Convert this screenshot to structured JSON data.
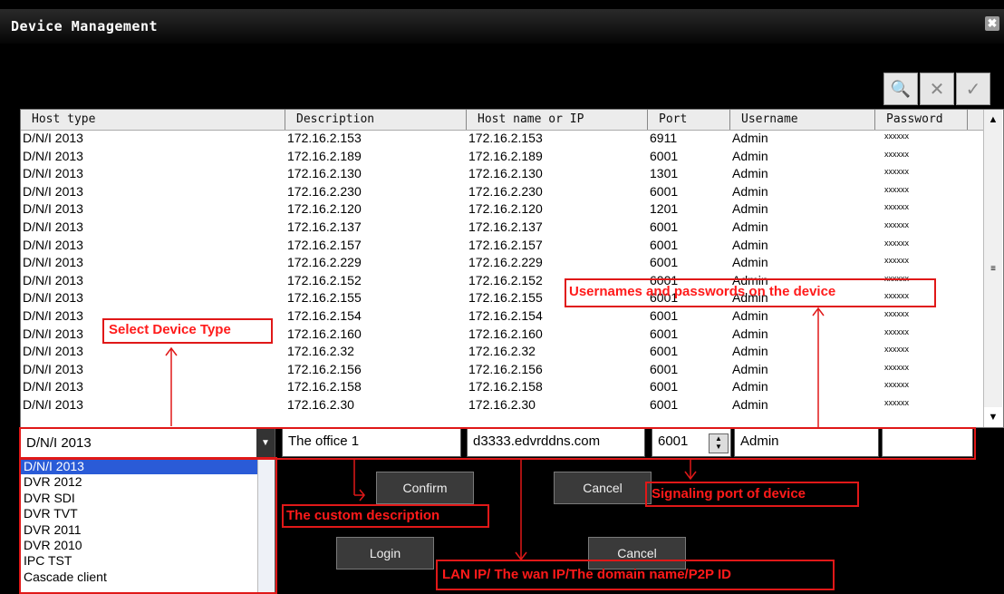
{
  "window": {
    "title": "Device Management",
    "close_glyph": "✖"
  },
  "toolbar": [
    {
      "icon": "search-icon",
      "glyph": "🔍"
    },
    {
      "icon": "delete-icon",
      "glyph": "✕"
    },
    {
      "icon": "check-icon",
      "glyph": "✓"
    }
  ],
  "grid": {
    "columns": [
      "Host type",
      "Description",
      "Host name or IP",
      "Port",
      "Username",
      "Password"
    ],
    "rows": [
      [
        "D/N/I 2013",
        "172.16.2.153",
        "172.16.2.153",
        "6911",
        "Admin",
        "xxxxxx"
      ],
      [
        "D/N/I 2013",
        "172.16.2.189",
        "172.16.2.189",
        "6001",
        "Admin",
        "xxxxxx"
      ],
      [
        "D/N/I 2013",
        "172.16.2.130",
        "172.16.2.130",
        "1301",
        "Admin",
        "xxxxxx"
      ],
      [
        "D/N/I 2013",
        "172.16.2.230",
        "172.16.2.230",
        "6001",
        "Admin",
        "xxxxxx"
      ],
      [
        "D/N/I 2013",
        "172.16.2.120",
        "172.16.2.120",
        "1201",
        "Admin",
        "xxxxxx"
      ],
      [
        "D/N/I 2013",
        "172.16.2.137",
        "172.16.2.137",
        "6001",
        "Admin",
        "xxxxxx"
      ],
      [
        "D/N/I 2013",
        "172.16.2.157",
        "172.16.2.157",
        "6001",
        "Admin",
        "xxxxxx"
      ],
      [
        "D/N/I 2013",
        "172.16.2.229",
        "172.16.2.229",
        "6001",
        "Admin",
        "xxxxxx"
      ],
      [
        "D/N/I 2013",
        "172.16.2.152",
        "172.16.2.152",
        "6001",
        "Admin",
        "xxxxxx"
      ],
      [
        "D/N/I 2013",
        "172.16.2.155",
        "172.16.2.155",
        "6001",
        "Admin",
        "xxxxxx"
      ],
      [
        "D/N/I 2013",
        "172.16.2.154",
        "172.16.2.154",
        "6001",
        "Admin",
        "xxxxxx"
      ],
      [
        "D/N/I 2013",
        "172.16.2.160",
        "172.16.2.160",
        "6001",
        "Admin",
        "xxxxxx"
      ],
      [
        "D/N/I 2013",
        "172.16.2.32",
        "172.16.2.32",
        "6001",
        "Admin",
        "xxxxxx"
      ],
      [
        "D/N/I 2013",
        "172.16.2.156",
        "172.16.2.156",
        "6001",
        "Admin",
        "xxxxxx"
      ],
      [
        "D/N/I 2013",
        "172.16.2.158",
        "172.16.2.158",
        "6001",
        "Admin",
        "xxxxxx"
      ],
      [
        "D/N/I 2013",
        "172.16.2.30",
        "172.16.2.30",
        "6001",
        "Admin",
        "xxxxxx"
      ]
    ]
  },
  "edit": {
    "host_type": "D/N/I 2013",
    "description": "The office 1",
    "host": "d3333.edvrddns.com",
    "port": "6001",
    "username": "Admin",
    "password": ""
  },
  "dropdown_options": [
    "D/N/I 2013",
    "DVR 2012",
    "DVR SDI",
    "DVR TVT",
    "DVR 2011",
    "DVR 2010",
    "IPC TST",
    "Cascade client"
  ],
  "buttons": {
    "confirm": "Confirm",
    "cancel": "Cancel",
    "login": "Login",
    "cancel2": "Cancel"
  },
  "annotations": {
    "select_type": "Select Device Type",
    "usernames": "Usernames and passwords on the device",
    "custom_desc": "The custom description",
    "signaling_port": "Signaling port of device",
    "lan_ip": "LAN IP/ The wan IP/The domain name/P2P ID"
  },
  "colors": {
    "annotation": "#e01818",
    "selection": "#2a5bd7"
  }
}
